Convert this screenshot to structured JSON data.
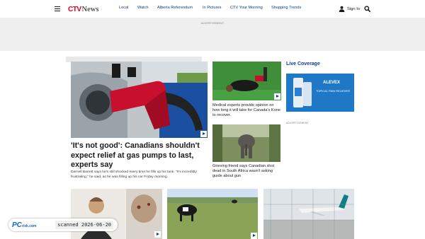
{
  "header": {
    "logo_mark": "CTV",
    "logo_word": "News",
    "nav": [
      {
        "label": "Local"
      },
      {
        "label": "Watch"
      },
      {
        "label": "Alberta Referendum"
      },
      {
        "label": "In Pictures"
      },
      {
        "label": "CTV Your Morning"
      },
      {
        "label": "Shopping Trends"
      }
    ],
    "signin_label": "Sign In"
  },
  "ads": {
    "top_label": "ADVERTISEMENT",
    "side_label": "ADVERTISEMENT",
    "side_brand": "ALEVEX",
    "side_tagline": "TOPICAL PAIN RELIEVER"
  },
  "hero": {
    "title": "'It's not good': Canadians shouldn't expect relief at gas pumps to last, experts say",
    "subtitle": "Darnell Barrett says he's still shocked every time he fills up his tank. \"It's incredibly frustrating,\" he said, as he was filling up his car Friday morning."
  },
  "stories": [
    {
      "title": "Medical experts provide opinion on how long it will take for Canada's Kone to recover."
    },
    {
      "title": "Grieving friend says Canadian shot dead in South Africa wasn't asking guide about gun"
    }
  ],
  "sidebar": {
    "live_title": "Live Coverage"
  },
  "watermark": {
    "logo_pc": "PC",
    "logo_risk": "risk",
    "logo_com": ".com",
    "scanned": "scanned 2026-06-20"
  }
}
